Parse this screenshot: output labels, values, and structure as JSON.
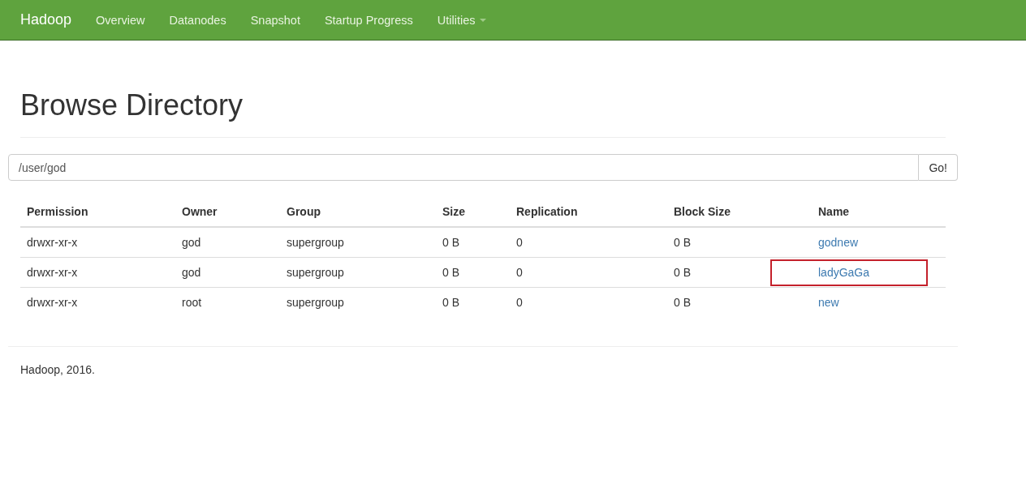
{
  "navbar": {
    "brand": "Hadoop",
    "items": [
      {
        "label": "Overview",
        "dropdown": false
      },
      {
        "label": "Datanodes",
        "dropdown": false
      },
      {
        "label": "Snapshot",
        "dropdown": false
      },
      {
        "label": "Startup Progress",
        "dropdown": false
      },
      {
        "label": "Utilities",
        "dropdown": true
      }
    ]
  },
  "page_title": "Browse Directory",
  "path_field": {
    "value": "/user/god",
    "button": "Go!"
  },
  "table": {
    "columns": [
      "Permission",
      "Owner",
      "Group",
      "Size",
      "Replication",
      "Block Size",
      "Name"
    ],
    "rows": [
      {
        "permission": "drwxr-xr-x",
        "owner": "god",
        "group": "supergroup",
        "size": "0 B",
        "replication": "0",
        "block_size": "0 B",
        "name": "godnew",
        "highlighted": false
      },
      {
        "permission": "drwxr-xr-x",
        "owner": "god",
        "group": "supergroup",
        "size": "0 B",
        "replication": "0",
        "block_size": "0 B",
        "name": "ladyGaGa",
        "highlighted": true
      },
      {
        "permission": "drwxr-xr-x",
        "owner": "root",
        "group": "supergroup",
        "size": "0 B",
        "replication": "0",
        "block_size": "0 B",
        "name": "new",
        "highlighted": false
      }
    ]
  },
  "footer": "Hadoop, 2016."
}
